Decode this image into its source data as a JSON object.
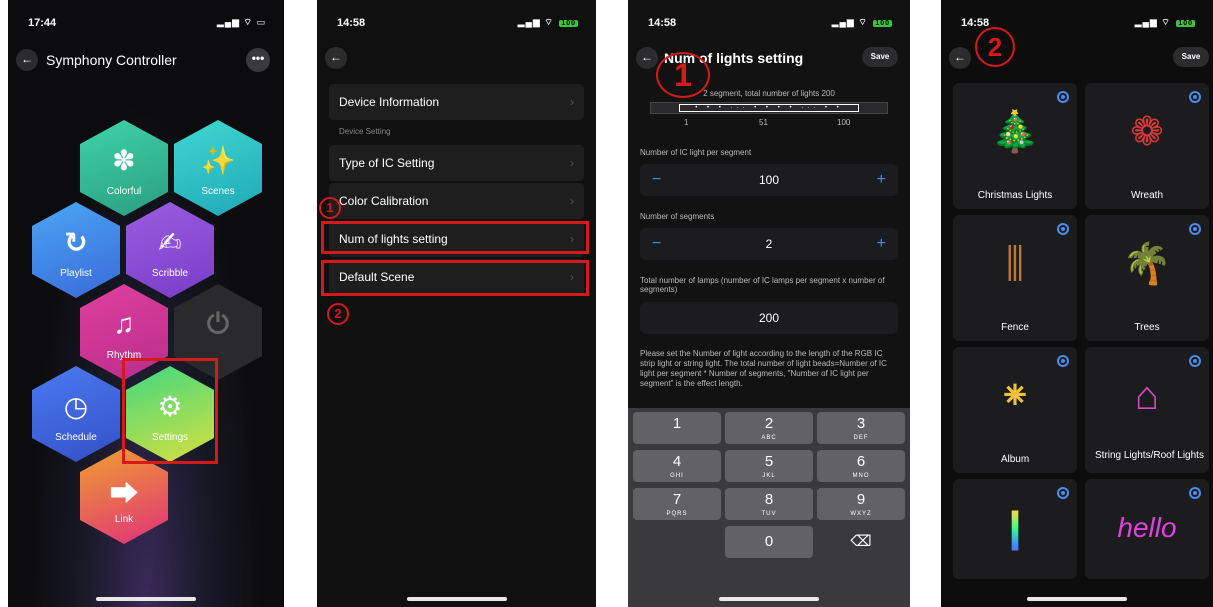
{
  "phone1": {
    "time": "17:44",
    "title": "Symphony Controller",
    "more": "•••",
    "hexes": [
      {
        "label": "Colorful",
        "icon": "✽"
      },
      {
        "label": "Scenes",
        "icon": "✨"
      },
      {
        "label": "Playlist",
        "icon": "↻"
      },
      {
        "label": "Scribble",
        "icon": "✍"
      },
      {
        "label": "Rhythm",
        "icon": "♫"
      },
      {
        "label": "",
        "icon": "⏻"
      },
      {
        "label": "Schedule",
        "icon": "◷"
      },
      {
        "label": "Settings",
        "icon": "⚙"
      },
      {
        "label": "Link",
        "icon": "⮕"
      }
    ]
  },
  "phone2": {
    "time": "14:58",
    "rows": [
      "Device Information",
      "Type of IC Setting",
      "Color Calibration",
      "Num of lights setting",
      "Default Scene"
    ],
    "section": "Device Setting",
    "num1": "1",
    "num2": "2"
  },
  "phone3": {
    "time": "14:58",
    "title": "Num of lights setting",
    "save": "Save",
    "summary": "2 segment,  total number of lights 200",
    "ticks": [
      "1",
      "51",
      "100"
    ],
    "label_per_segment": "Number of IC light per segment",
    "value_per_segment": "100",
    "label_segments": "Number of segments",
    "value_segments": "2",
    "label_total": "Total number of lamps (number of IC lamps per segment x number of segments)",
    "value_total": "200",
    "note": "Please set the Number of light according to the length of the RGB IC strip light or string light. The total number of light beads=Number of IC light per segment  *  Number of segments, \"Number of IC light per segment\" is the effect length.",
    "keys": [
      {
        "n": "1",
        "s": ""
      },
      {
        "n": "2",
        "s": "ABC"
      },
      {
        "n": "3",
        "s": "DEF"
      },
      {
        "n": "4",
        "s": "GHI"
      },
      {
        "n": "5",
        "s": "JKL"
      },
      {
        "n": "6",
        "s": "MNO"
      },
      {
        "n": "7",
        "s": "PQRS"
      },
      {
        "n": "8",
        "s": "TUV"
      },
      {
        "n": "9",
        "s": "WXYZ"
      },
      {
        "n": "0",
        "s": ""
      }
    ],
    "backspace": "⌫",
    "num": "1"
  },
  "phone4": {
    "time": "14:58",
    "save": "Save",
    "num": "2",
    "tiles": [
      {
        "name": "Christmas Lights",
        "art": "🎄"
      },
      {
        "name": "Wreath",
        "art": "❁"
      },
      {
        "name": "Fence",
        "art": "⫼"
      },
      {
        "name": "Trees",
        "art": "🌴"
      },
      {
        "name": "Album",
        "art": "⁕"
      },
      {
        "name": "String Lights/Roof Lights",
        "art": "⌂"
      },
      {
        "name": "",
        "art": "❙"
      },
      {
        "name": "",
        "art": "hello"
      }
    ]
  },
  "icons": {
    "back": "←",
    "chevron": "›"
  },
  "colors": {
    "accent": "#4a8cf0",
    "highlight": "#d61a1a",
    "battery": "#3ec33e"
  }
}
